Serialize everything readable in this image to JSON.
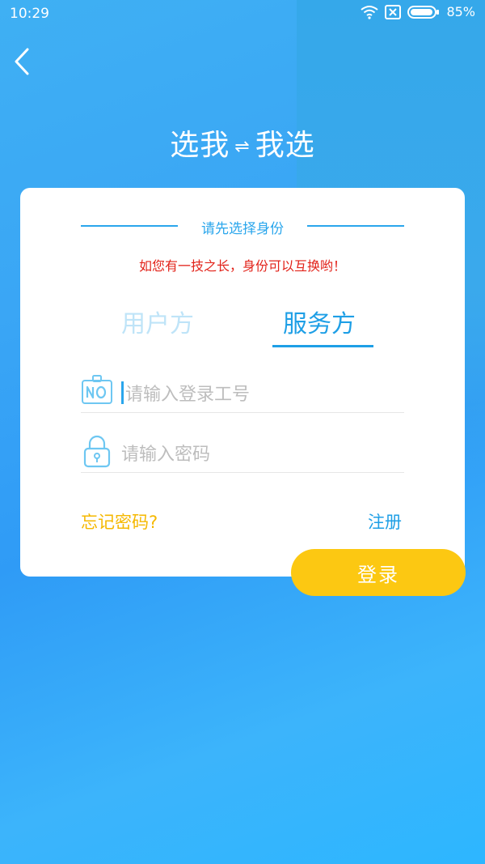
{
  "status_bar": {
    "time": "10:29",
    "battery": "85%",
    "icons": [
      "wifi-icon",
      "sim-icon",
      "battery-icon"
    ]
  },
  "header": {
    "title_left": "选我",
    "swap_symbol": "⇌",
    "title_right": "我选",
    "back_icon": "chevron-left-icon"
  },
  "card": {
    "heading": "请先选择身份",
    "notice": "如您有一技之长，身份可以互换哟！",
    "tabs": [
      {
        "label": "用户方",
        "active": false
      },
      {
        "label": "服务方",
        "active": true
      }
    ],
    "fields": {
      "id_placeholder": "请输入登录工号",
      "password_placeholder": "请输入密码"
    },
    "forgot_label": "忘记密码?",
    "register_label": "注册"
  },
  "login": {
    "label": "登录"
  },
  "colors": {
    "accent": "#1e9fe6",
    "warning": "#e2231a",
    "button": "#fcc812",
    "forgot": "#f5b800"
  }
}
